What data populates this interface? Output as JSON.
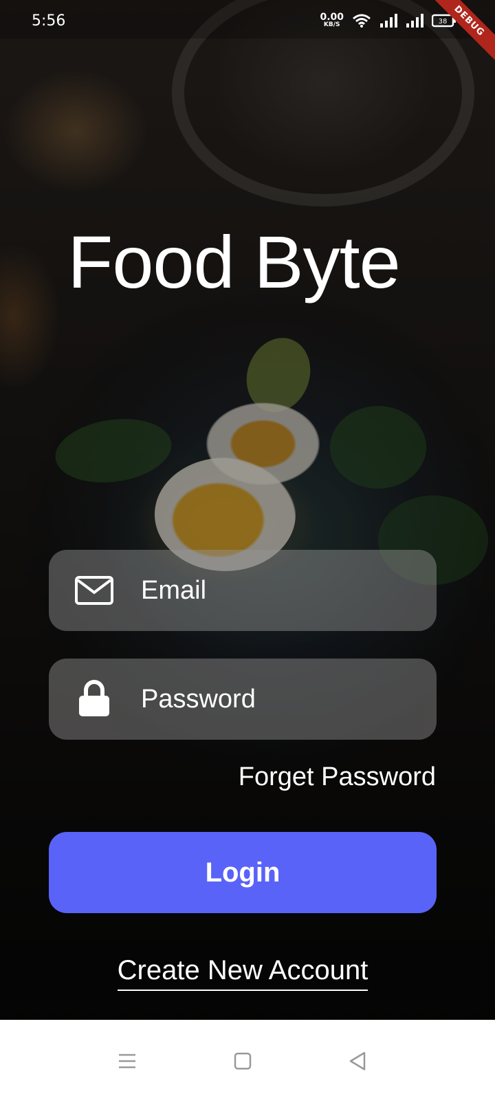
{
  "status_bar": {
    "time": "5:56",
    "net_speed_value": "0.00",
    "net_speed_unit": "KB/S",
    "battery_level": "38",
    "debug_banner": "DEBUG",
    "icons": [
      "wifi-icon",
      "signal-icon",
      "signal-icon",
      "battery-icon"
    ]
  },
  "app": {
    "title": "Food Byte"
  },
  "login_form": {
    "email_placeholder": "Email",
    "password_placeholder": "Password",
    "forgot_password": "Forget Password",
    "login_button": "Login",
    "create_account": "Create New Account"
  },
  "icons": {
    "email": "mail-icon",
    "password": "lock-icon"
  },
  "colors": {
    "accent": "#5A63F8",
    "field_bg": "rgba(150,150,150,0.45)",
    "text": "#FFFFFF"
  },
  "nav_bar": {
    "buttons": [
      "menu-icon",
      "home-square-icon",
      "back-triangle-icon"
    ]
  }
}
